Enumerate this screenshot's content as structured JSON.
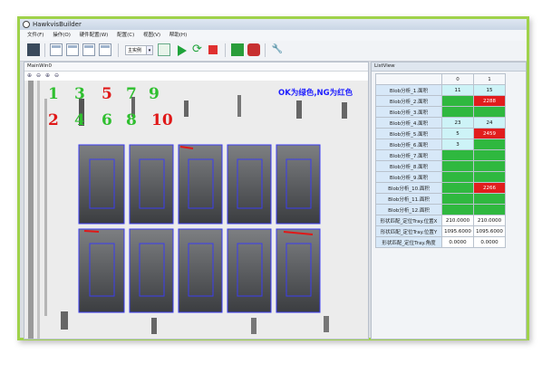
{
  "window": {
    "title": "HawkvisBuilder"
  },
  "menu": [
    "文件(F)",
    "操作(O)",
    "硬件配置(W)",
    "配置(C)",
    "视图(V)",
    "帮助(H)"
  ],
  "toolbar": {
    "combo_value": "主实例"
  },
  "main_panel": {
    "title": "MainWin0",
    "overlay_text": "OK为绿色,NG为红色",
    "overlay_color": "#2020ff",
    "digits_top": [
      {
        "text": "1",
        "color": "#2fbf2f"
      },
      {
        "text": "3",
        "color": "#2fbf2f"
      },
      {
        "text": "5",
        "color": "#e01818"
      },
      {
        "text": "7",
        "color": "#2fbf2f"
      },
      {
        "text": "9",
        "color": "#2fbf2f"
      }
    ],
    "digits_bottom": [
      {
        "text": "2",
        "color": "#e01818"
      },
      {
        "text": "4",
        "color": "#2fbf2f"
      },
      {
        "text": "6",
        "color": "#2fbf2f"
      },
      {
        "text": "8",
        "color": "#2fbf2f"
      },
      {
        "text": "10",
        "color": "#e01818"
      }
    ]
  },
  "list_panel": {
    "title": "ListView",
    "columns": [
      "",
      "0",
      "1"
    ],
    "rows": [
      {
        "label": "Blob分析_1.面积",
        "cells": [
          {
            "v": "11",
            "s": "c"
          },
          {
            "v": "15",
            "s": "c"
          }
        ]
      },
      {
        "label": "Blob分析_2.面积",
        "cells": [
          {
            "v": "0",
            "s": "g"
          },
          {
            "v": "2288",
            "s": "r"
          }
        ]
      },
      {
        "label": "Blob分析_3.面积",
        "cells": [
          {
            "v": "0",
            "s": "g"
          },
          {
            "v": "0",
            "s": "g"
          }
        ]
      },
      {
        "label": "Blob分析_4.面积",
        "cells": [
          {
            "v": "23",
            "s": "c"
          },
          {
            "v": "24",
            "s": "c"
          }
        ]
      },
      {
        "label": "Blob分析_5.面积",
        "cells": [
          {
            "v": "5",
            "s": "c"
          },
          {
            "v": "2459",
            "s": "r"
          }
        ]
      },
      {
        "label": "Blob分析_6.面积",
        "cells": [
          {
            "v": "3",
            "s": "c"
          },
          {
            "v": "0",
            "s": "g"
          }
        ]
      },
      {
        "label": "Blob分析_7.面积",
        "cells": [
          {
            "v": "0",
            "s": "g"
          },
          {
            "v": "0",
            "s": "g"
          }
        ]
      },
      {
        "label": "Blob分析_8.面积",
        "cells": [
          {
            "v": "0",
            "s": "g"
          },
          {
            "v": "0",
            "s": "g"
          }
        ]
      },
      {
        "label": "Blob分析_9.面积",
        "cells": [
          {
            "v": "0",
            "s": "g"
          },
          {
            "v": "0",
            "s": "g"
          }
        ]
      },
      {
        "label": "Blob分析_10.面积",
        "cells": [
          {
            "v": "0",
            "s": "g"
          },
          {
            "v": "2266",
            "s": "r"
          }
        ]
      },
      {
        "label": "Blob分析_11.面积",
        "cells": [
          {
            "v": "0",
            "s": "g"
          },
          {
            "v": "0",
            "s": "g"
          }
        ]
      },
      {
        "label": "Blob分析_12.面积",
        "cells": [
          {
            "v": "0",
            "s": "g"
          },
          {
            "v": "0",
            "s": "g"
          }
        ]
      },
      {
        "label": "形状匹配_定位Tray.位置X",
        "cells": [
          {
            "v": "210.0000",
            "s": "w"
          },
          {
            "v": "210.0000",
            "s": "w"
          }
        ]
      },
      {
        "label": "形状匹配_定位Tray.位置Y",
        "cells": [
          {
            "v": "1095.6000",
            "s": "w"
          },
          {
            "v": "1095.6000",
            "s": "w"
          }
        ]
      },
      {
        "label": "形状匹配_定位Tray.角度",
        "cells": [
          {
            "v": "0.0000",
            "s": "w"
          },
          {
            "v": "0.0000",
            "s": "w"
          }
        ]
      }
    ]
  }
}
